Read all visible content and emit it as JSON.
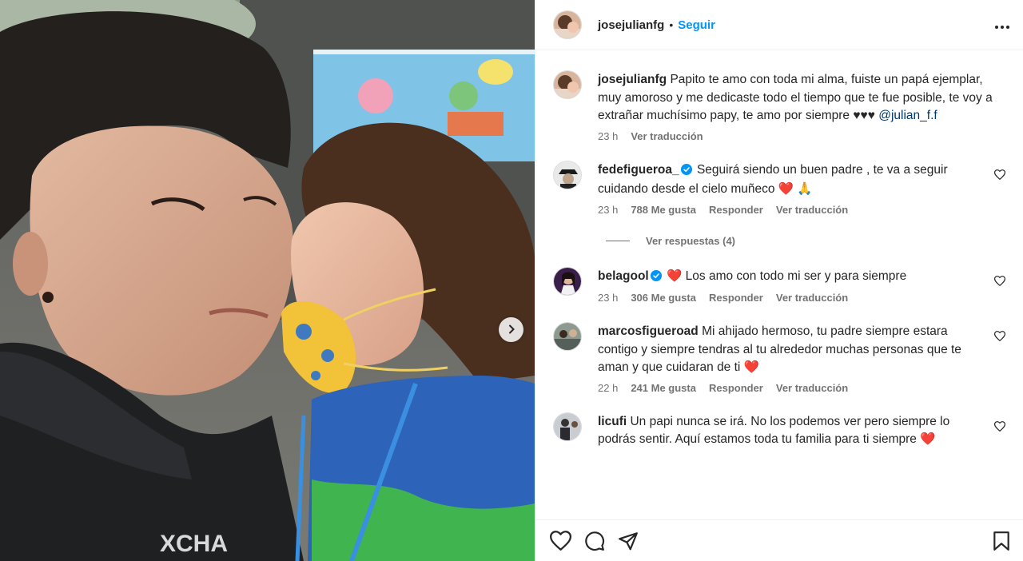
{
  "post": {
    "author": "josejulianfg",
    "follow_label": "Seguir",
    "separator": "•",
    "more_label": "•••"
  },
  "caption": {
    "username": "josejulianfg",
    "text": "Papito te amo con toda mi alma, fuiste un papá ejemplar, muy amoroso y me dedicaste todo el tiempo que te fue posible, te voy a extrañar muchísimo papy, te amo por siempre ♥♥♥ ",
    "mention": "@julian_f.f",
    "time": "23 h",
    "translate": "Ver traducción"
  },
  "comments": [
    {
      "username": "fedefigueroa_",
      "verified": true,
      "text": "Seguirá siendo un buen padre , te va a seguir cuidando desde el cielo muñeco",
      "emoji": "❤️ 🙏",
      "time": "23 h",
      "likes": "788 Me gusta",
      "reply": "Responder",
      "translate": "Ver traducción",
      "replies_label": "Ver respuestas (4)"
    },
    {
      "username": "belagool",
      "verified": true,
      "text": "Los amo con todo mi ser y para siempre",
      "emoji": "❤️",
      "time": "23 h",
      "likes": "306 Me gusta",
      "reply": "Responder",
      "translate": "Ver traducción"
    },
    {
      "username": "marcosfigueroad",
      "verified": false,
      "text": "Mi ahijado hermoso, tu padre siempre estara contigo y siempre tendras al tu alrededor muchas personas que te aman y que cuidaran de ti",
      "emoji": "❤️",
      "time": "22 h",
      "likes": "241 Me gusta",
      "reply": "Responder",
      "translate": "Ver traducción"
    },
    {
      "username": "licufi",
      "verified": false,
      "text": "Un papi nunca se irá. No los podemos ver pero siempre lo podrás sentir. Aquí estamos toda tu familia para ti siempre",
      "emoji": "❤️"
    }
  ],
  "icons": {
    "like": "heart-icon",
    "comment": "comment-icon",
    "share": "share-icon",
    "save": "bookmark-icon",
    "next": "chevron-right-icon",
    "verified": "verified-badge-icon"
  },
  "colors": {
    "follow": "#0095f6",
    "verified": "#0095f6",
    "heart": "#ff3040",
    "meta": "#737373",
    "text": "#262626"
  }
}
